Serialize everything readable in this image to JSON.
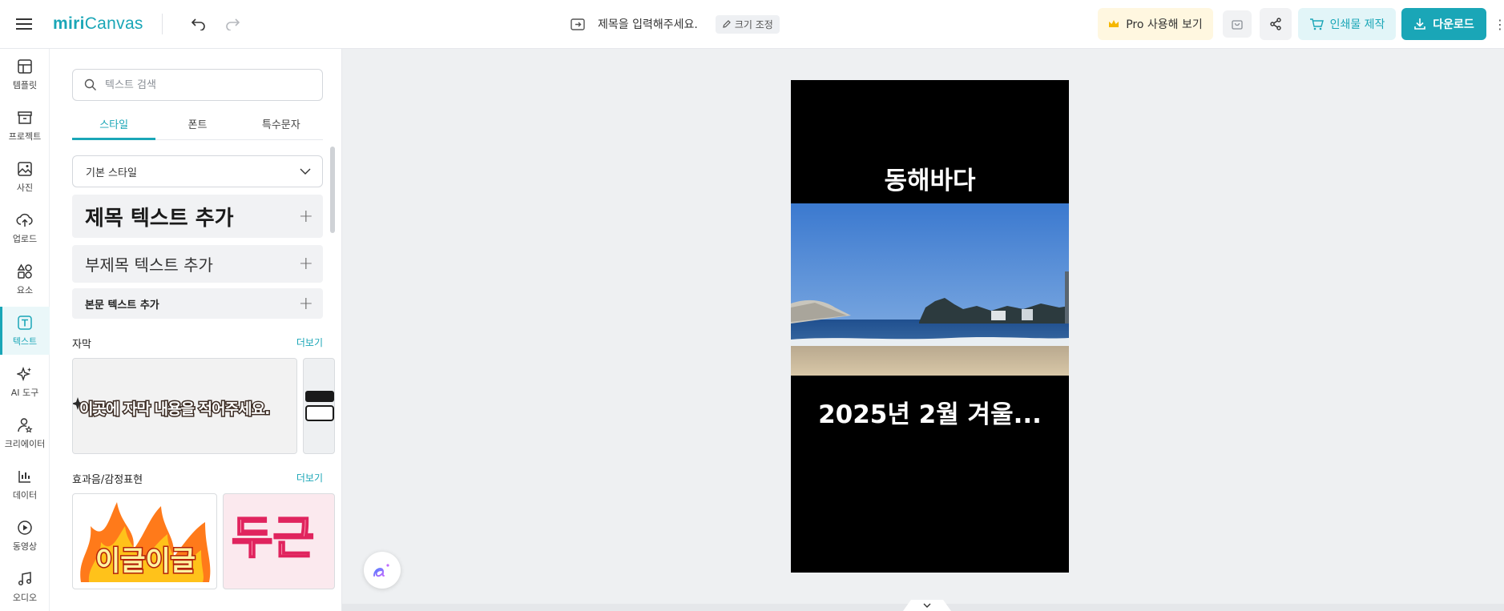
{
  "app": {
    "logo_prefix": "miri",
    "logo_suffix": "Canvas",
    "brand_color": "#1aa6b7"
  },
  "header": {
    "document_title_placeholder": "제목을 입력해주세요.",
    "resize_label": "크기 조정",
    "pro_label": "Pro 사용해 보기",
    "print_label": "인쇄물 제작",
    "download_label": "다운로드"
  },
  "rail": {
    "items": [
      {
        "label": "템플릿",
        "icon": "template-icon"
      },
      {
        "label": "프로젝트",
        "icon": "project-icon"
      },
      {
        "label": "사진",
        "icon": "photo-icon"
      },
      {
        "label": "업로드",
        "icon": "upload-icon"
      },
      {
        "label": "요소",
        "icon": "elements-icon"
      },
      {
        "label": "텍스트",
        "icon": "text-icon",
        "active": true
      },
      {
        "label": "AI 도구",
        "icon": "ai-tools-icon"
      },
      {
        "label": "크리에이터",
        "icon": "creator-icon"
      },
      {
        "label": "데이터",
        "icon": "data-icon"
      },
      {
        "label": "동영상",
        "icon": "video-icon"
      },
      {
        "label": "오디오",
        "icon": "audio-icon"
      }
    ]
  },
  "panel": {
    "search_placeholder": "텍스트 검색",
    "tabs": [
      {
        "label": "스타일",
        "active": true
      },
      {
        "label": "폰트"
      },
      {
        "label": "특수문자"
      }
    ],
    "style_select_value": "기본 스타일",
    "add_title": "제목 텍스트 추가",
    "add_subtitle": "부제목 텍스트 추가",
    "add_body": "본문 텍스트 추가",
    "sections": [
      {
        "title": "자막",
        "more": "더보기",
        "card_text": "이곳에 자막 내용을 적어주세요."
      },
      {
        "title": "효과음/감정표현",
        "more": "더보기",
        "card1_text": "이글이글",
        "card2_text": "두근"
      }
    ]
  },
  "canvas": {
    "title_text": "동해바다",
    "subtitle_text": "2025년 2월 겨울..."
  }
}
